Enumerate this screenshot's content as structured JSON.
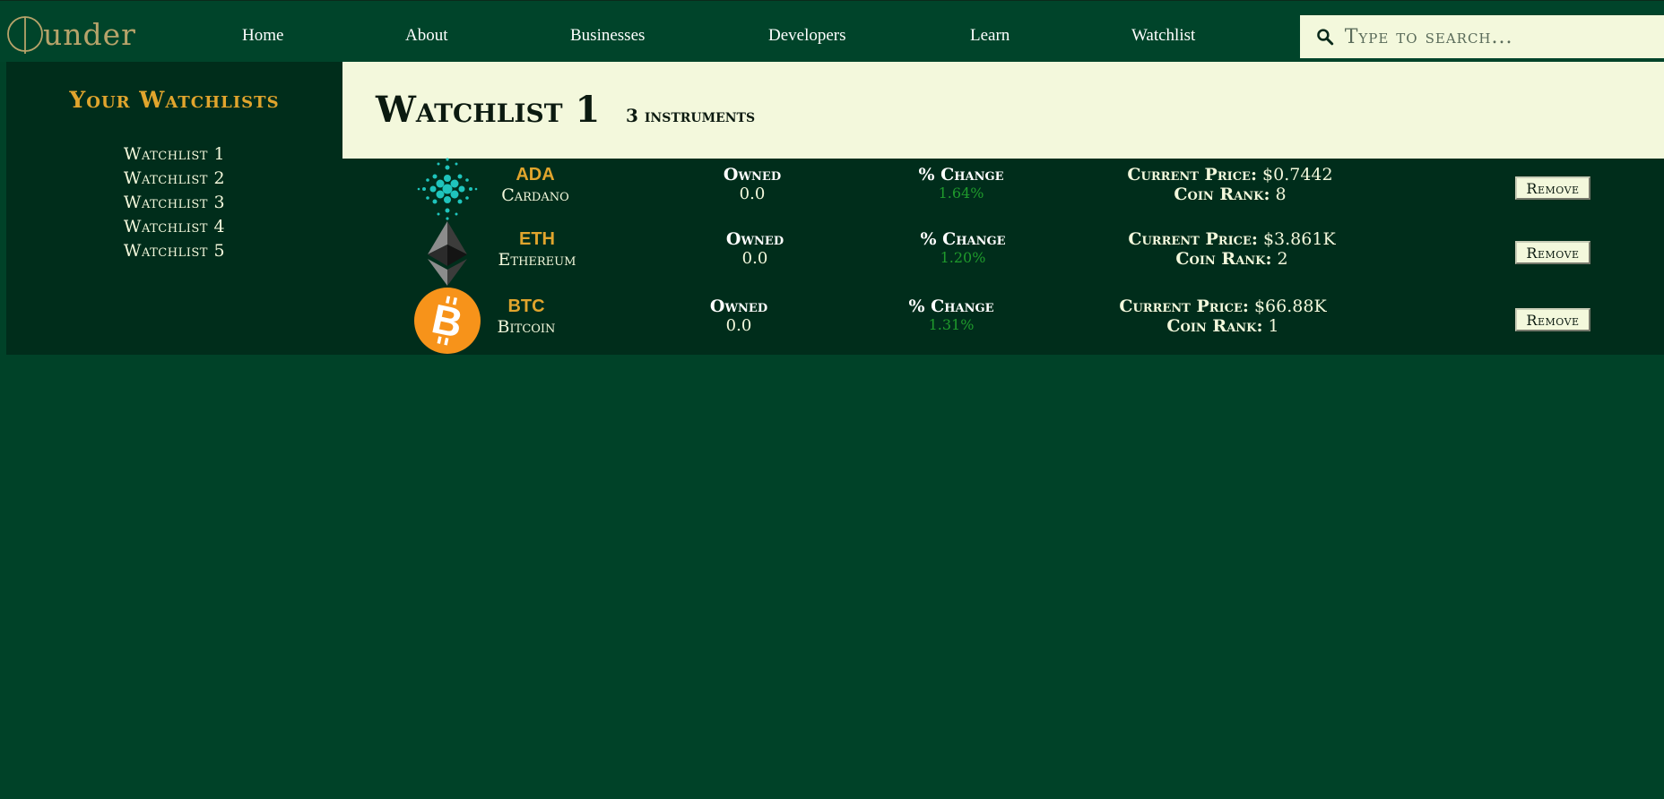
{
  "nav": {
    "logo_text": "under",
    "links": [
      "Home",
      "About",
      "Businesses",
      "Developers",
      "Learn",
      "Watchlist"
    ],
    "search_placeholder": "Type to search..."
  },
  "sidebar": {
    "title": "Your Watchlists",
    "watchlists": [
      "Watchlist 1",
      "Watchlist 2",
      "Watchlist 3",
      "Watchlist 4",
      "Watchlist 5"
    ]
  },
  "header": {
    "title": "Watchlist 1",
    "count": "3 instruments"
  },
  "columns": {
    "owned": "Owned",
    "change": "% Change",
    "price": "Current Price:",
    "rank": "Coin Rank:",
    "remove": "Remove"
  },
  "coins": [
    {
      "symbol": "ADA",
      "name": "Cardano",
      "owned": "0.0",
      "change": "1.64%",
      "price": "$0.7442",
      "rank": "8",
      "icon": "cardano-icon"
    },
    {
      "symbol": "ETH",
      "name": "Ethereum",
      "owned": "0.0",
      "change": "1.20%",
      "price": "$3.861K",
      "rank": "2",
      "icon": "ethereum-icon"
    },
    {
      "symbol": "BTC",
      "name": "Bitcoin",
      "owned": "0.0",
      "change": "1.31%",
      "price": "$66.88K",
      "rank": "1",
      "icon": "bitcoin-icon"
    }
  ],
  "colors": {
    "background": "#004228",
    "panel_dark": "#002d1b",
    "cream": "#f3f8dc",
    "accent_gold": "#e1a52d",
    "positive_change": "#1f9a2c",
    "cardano_teal": "#1fc4bc",
    "bitcoin_orange": "#f7931a"
  }
}
